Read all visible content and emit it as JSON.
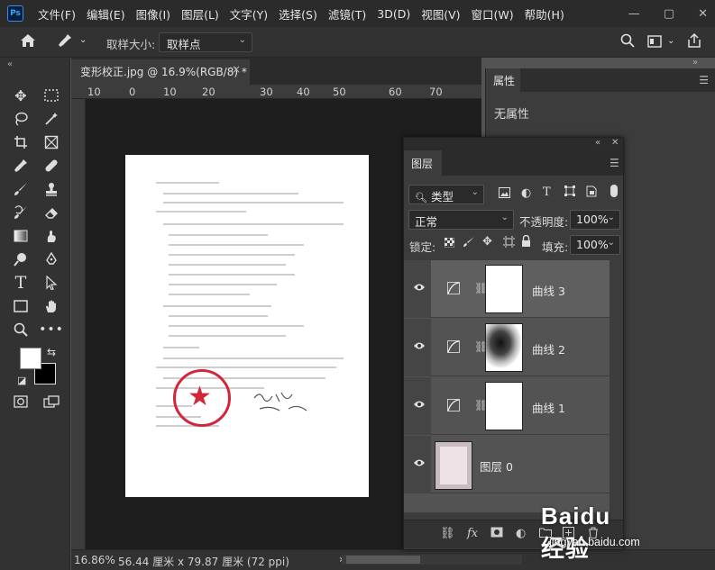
{
  "app": {
    "logo": "Ps"
  },
  "menu": [
    "文件(F)",
    "编辑(E)",
    "图像(I)",
    "图层(L)",
    "文字(Y)",
    "选择(S)",
    "滤镜(T)",
    "3D(D)",
    "视图(V)",
    "窗口(W)",
    "帮助(H)"
  ],
  "window_controls": {
    "minimize": "—",
    "restore": "▢",
    "close": "✕"
  },
  "options_bar": {
    "sample_size_label": "取样大小:",
    "sample_size_value": "取样点",
    "home_icon": "home-icon",
    "eyedropper_icon": "eyedropper-icon"
  },
  "document": {
    "tab_title": "变形校正.jpg @ 16.9%(RGB/8) *",
    "close": "×"
  },
  "ruler_top": [
    "10",
    "0",
    "10",
    "20",
    "30",
    "40",
    "50",
    "60",
    "70"
  ],
  "properties": {
    "tab": "属性",
    "content": "无属性"
  },
  "layers": {
    "tab": "图层",
    "filter_kind": "类型",
    "blend_mode": "正常",
    "opacity_label": "不透明度:",
    "opacity_value": "100%",
    "lock_label": "锁定:",
    "fill_label": "填充:",
    "fill_value": "100%",
    "items": [
      {
        "name": "曲线 3",
        "type": "adjustment",
        "mask": "white"
      },
      {
        "name": "曲线 2",
        "type": "adjustment",
        "mask": "dark"
      },
      {
        "name": "曲线 1",
        "type": "adjustment",
        "mask": "white"
      },
      {
        "name": "图层 0",
        "type": "image"
      }
    ]
  },
  "status": {
    "zoom": "16.86%",
    "doc_size": "56.44 厘米 x 79.87 厘米 (72 ppi)",
    "arrow": "›"
  },
  "watermark": {
    "logo": "Baidu经验",
    "url": "jingyan.baidu.com"
  },
  "colors": {
    "menubar": "#2b2b2b",
    "panel": "#3c3c3c",
    "canvas": "#1e1e1e",
    "stamp": "#d4263a",
    "ps_blue": "#31a8ff"
  }
}
